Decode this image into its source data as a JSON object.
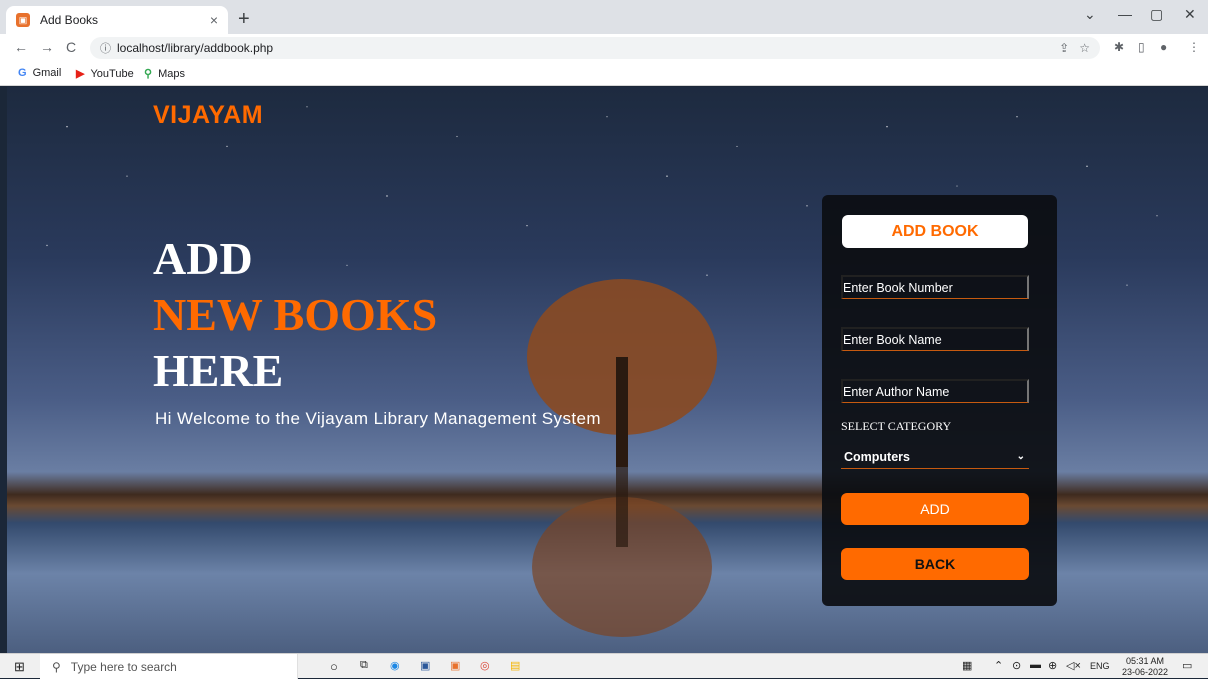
{
  "browser": {
    "tab_title": "Add Books",
    "tab_close": "×",
    "new_tab": "+",
    "url": "localhost/library/addbook.php",
    "bookmarks": [
      {
        "icon": "G",
        "label": "Gmail"
      },
      {
        "icon": "▶",
        "label": "YouTube"
      },
      {
        "icon": "⚲",
        "label": "Maps"
      }
    ]
  },
  "site": {
    "logo": "VIJAYAM",
    "hero_line1": "ADD",
    "hero_line2": "NEW BOOKS",
    "hero_line3": "HERE",
    "welcome": "Hi Welcome to the Vijayam Library Management System"
  },
  "form": {
    "title": "ADD BOOK",
    "book_number_placeholder": "Enter Book Number",
    "book_name_placeholder": "Enter Book Name",
    "author_name_placeholder": "Enter Author Name",
    "category_label": "SELECT CATEGORY",
    "category_value": "Computers",
    "add_button": "ADD",
    "back_button": "BACK"
  },
  "taskbar": {
    "search_placeholder": "Type here to search",
    "language": "ENG",
    "time": "05:31 AM",
    "date": "23-06-2022"
  },
  "colors": {
    "accent": "#ff6a00",
    "card_bg": "#0c0e12"
  }
}
